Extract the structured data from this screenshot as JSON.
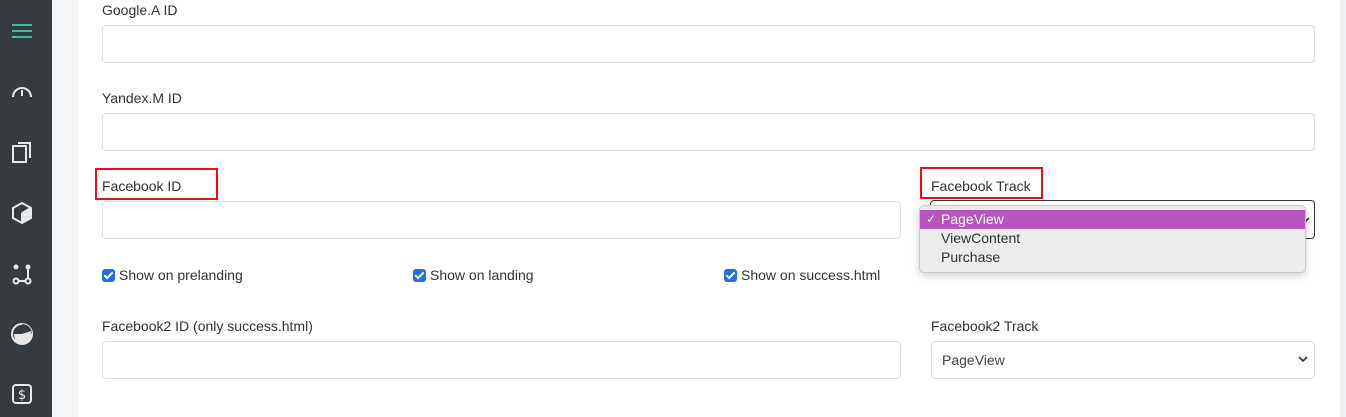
{
  "sidebar": {
    "icons": [
      "menu-icon",
      "dashboard-gauge-icon",
      "documents-icon",
      "box-icon",
      "git-branch-icon",
      "pie-chart-icon",
      "dollar-icon"
    ],
    "accent_color": "#3bbf9e"
  },
  "form": {
    "google_label": "Google.A ID",
    "google_value": "",
    "yandex_label": "Yandex.M ID",
    "yandex_value": "",
    "facebook_label": "Facebook ID",
    "facebook_value": "",
    "facebook_track_label": "Facebook Track",
    "facebook_track_options": [
      "PageView",
      "ViewContent",
      "Purchase"
    ],
    "facebook_track_selected": "PageView",
    "checkboxes": [
      {
        "label": "Show on prelanding",
        "checked": true
      },
      {
        "label": "Show on landing",
        "checked": true
      },
      {
        "label": "Show on success.html",
        "checked": true
      }
    ],
    "facebook2_label": "Facebook2 ID (only success.html)",
    "facebook2_value": "",
    "facebook2_track_label": "Facebook2 Track",
    "facebook2_track_value": "PageView"
  },
  "colors": {
    "highlight_box": "#e5101a",
    "dropdown_selected": "#b854bd",
    "checkbox": "#1f6fe0"
  }
}
